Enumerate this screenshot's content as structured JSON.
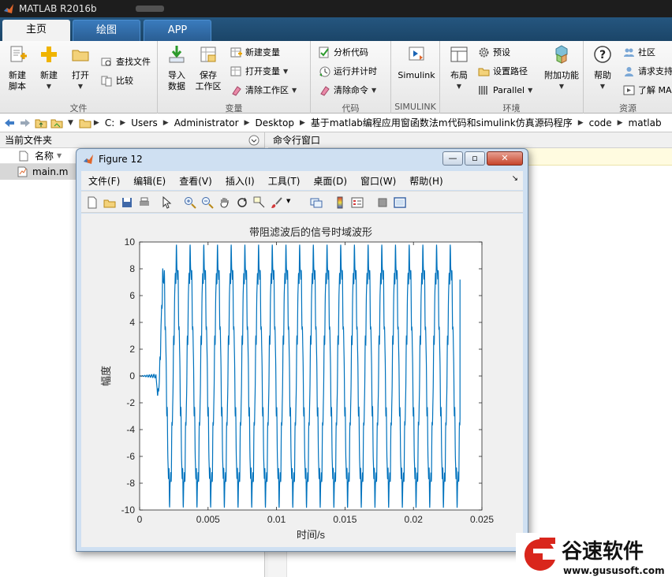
{
  "app": {
    "title": "MATLAB R2016b"
  },
  "tabs": [
    {
      "label": "主页",
      "active": true
    },
    {
      "label": "绘图",
      "active": false
    },
    {
      "label": "APP",
      "active": false
    }
  ],
  "ribbon": {
    "file": {
      "label": "文件",
      "new_script": [
        "新建",
        "脚本"
      ],
      "new": "新建",
      "open": "打开",
      "find_files": "查找文件",
      "compare": "比较"
    },
    "variable": {
      "label": "变量",
      "import_data": [
        "导入",
        "数据"
      ],
      "save_workspace": [
        "保存",
        "工作区"
      ],
      "new_variable": "新建变量",
      "open_variable": "打开变量",
      "clear_workspace": "清除工作区"
    },
    "code": {
      "label": "代码",
      "analyze_code": "分析代码",
      "run_and_time": "运行并计时",
      "clear_commands": "清除命令"
    },
    "simulink": {
      "label": "SIMULINK",
      "simulink": "Simulink"
    },
    "environment": {
      "label": "环境",
      "layout": "布局",
      "preferences": "预设",
      "set_path": "设置路径",
      "parallel": "Parallel",
      "addons": "附加功能"
    },
    "resources": {
      "label": "资源",
      "help": "帮助",
      "community": "社区",
      "request_support": "请求支持",
      "learn_matlab": "了解 MA"
    }
  },
  "address": {
    "crumbs": [
      "C:",
      "Users",
      "Administrator",
      "Desktop",
      "基于matlab编程应用窗函数法m代码和simulink仿真源码程序",
      "code",
      "matlab"
    ]
  },
  "current_folder": {
    "title": "当前文件夹",
    "column_name": "名称",
    "files": [
      "main.m"
    ]
  },
  "command_window": {
    "title": "命令行窗口"
  },
  "figure": {
    "title": "Figure 12",
    "menu": [
      "文件(F)",
      "编辑(E)",
      "查看(V)",
      "插入(I)",
      "工具(T)",
      "桌面(D)",
      "窗口(W)",
      "帮助(H)"
    ]
  },
  "chart_data": {
    "type": "line",
    "title": "带阻滤波后的信号时域波形",
    "xlabel": "时间/s",
    "ylabel": "幅度",
    "xlim": [
      0,
      0.025
    ],
    "ylim": [
      -10,
      10
    ],
    "xticks": [
      "0",
      "0.005",
      "0.01",
      "0.015",
      "0.02",
      "0.025"
    ],
    "yticks": [
      "-10",
      "-8",
      "-6",
      "-4",
      "-2",
      "0",
      "2",
      "4",
      "6",
      "8",
      "10"
    ],
    "grid": false,
    "series": [
      {
        "color": "#0072BD",
        "x": [
          0,
          0.0006,
          0.0009,
          0.0011,
          0.0013,
          0.0015,
          0.0017,
          0.0018,
          0.0021,
          0.0025,
          0.003,
          0.005,
          0.01,
          0.015,
          0.02,
          0.0225,
          0.023,
          0.0232,
          0.0234
        ],
        "y": [
          0,
          0.2,
          -0.5,
          1.5,
          4.0,
          9.8,
          -9.5,
          9.8,
          -10,
          9.8,
          -10,
          9.8,
          9.8,
          9.8,
          9.8,
          9.8,
          -10,
          4.0,
          7.2
        ],
        "envelope_max": 9.8,
        "envelope_min": -10,
        "frequency_hz": 1000,
        "start_time": 0.0012,
        "end_time": 0.0234,
        "final_value": 7.2
      }
    ]
  },
  "watermark": {
    "name": "谷速软件",
    "url": "www.gususoft.com"
  },
  "colors": {
    "tab_strip": "#1f4e79",
    "plot_line": "#0072BD",
    "watermark_red": "#d9261c"
  }
}
